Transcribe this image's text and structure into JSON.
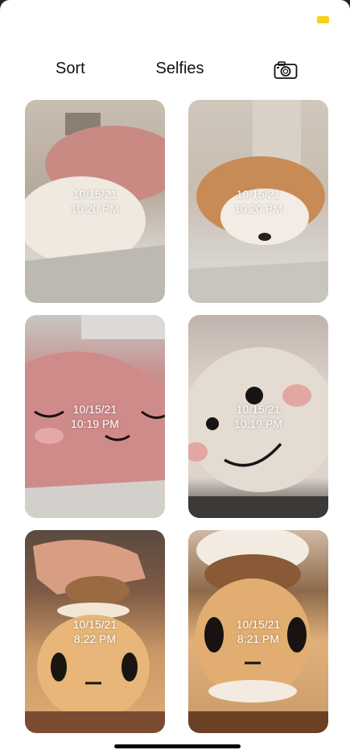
{
  "status": {
    "indicator_color": "#f7d21c"
  },
  "header": {
    "sort_label": "Sort",
    "title": "Selfies",
    "camera_icon": "camera-icon"
  },
  "photos": [
    {
      "date": "10/15/21",
      "time": "10:20 PM"
    },
    {
      "date": "10/15/21",
      "time": "10:20 PM"
    },
    {
      "date": "10/15/21",
      "time": "10:19 PM"
    },
    {
      "date": "10/15/21",
      "time": "10:19 PM"
    },
    {
      "date": "10/15/21",
      "time": "8:22 PM"
    },
    {
      "date": "10/15/21",
      "time": "8:21 PM"
    }
  ]
}
